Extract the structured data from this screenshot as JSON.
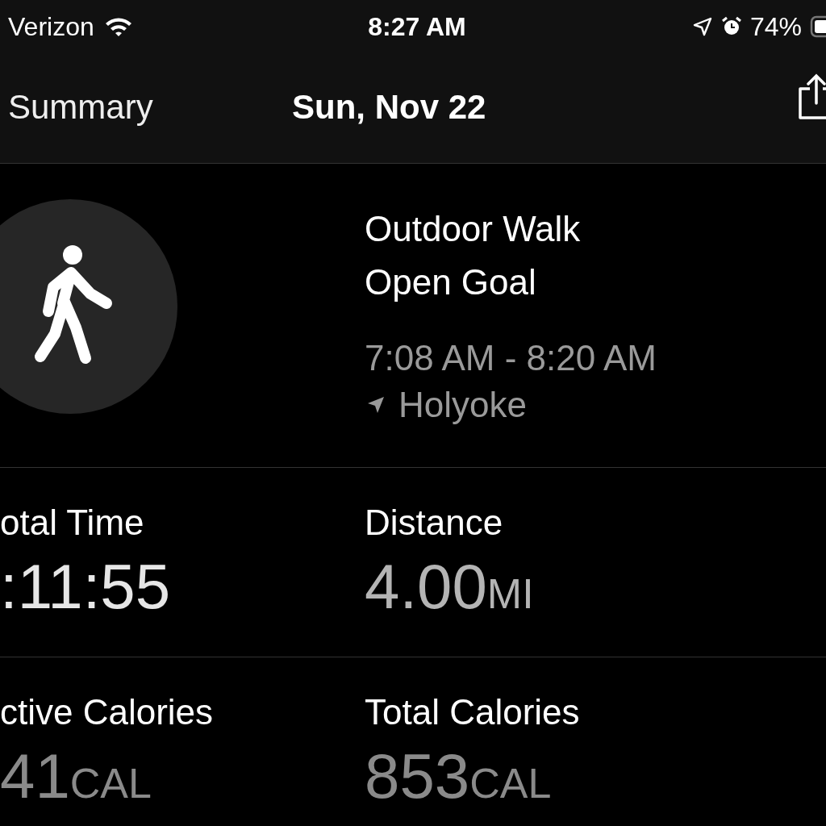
{
  "status_bar": {
    "carrier": "Verizon",
    "time": "8:27 AM",
    "battery": "74%"
  },
  "nav": {
    "back": "Summary",
    "title": "Sun, Nov 22"
  },
  "workout": {
    "name": "Outdoor Walk",
    "goal": "Open Goal",
    "time_range": "7:08 AM - 8:20 AM",
    "location": "Holyoke"
  },
  "stats": [
    {
      "label": "otal Time",
      "value": ":11:55",
      "color": "#e6e6e6"
    },
    {
      "label": "Distance",
      "value": "4.00",
      "unit": "MI",
      "color": "#b4b4b4"
    },
    {
      "label": "ctive Calories",
      "value": "41",
      "unit": "CAL",
      "color": "#8a8a8a"
    },
    {
      "label": "Total Calories",
      "value": "853",
      "unit": "CAL",
      "color": "#8a8a8a"
    }
  ]
}
